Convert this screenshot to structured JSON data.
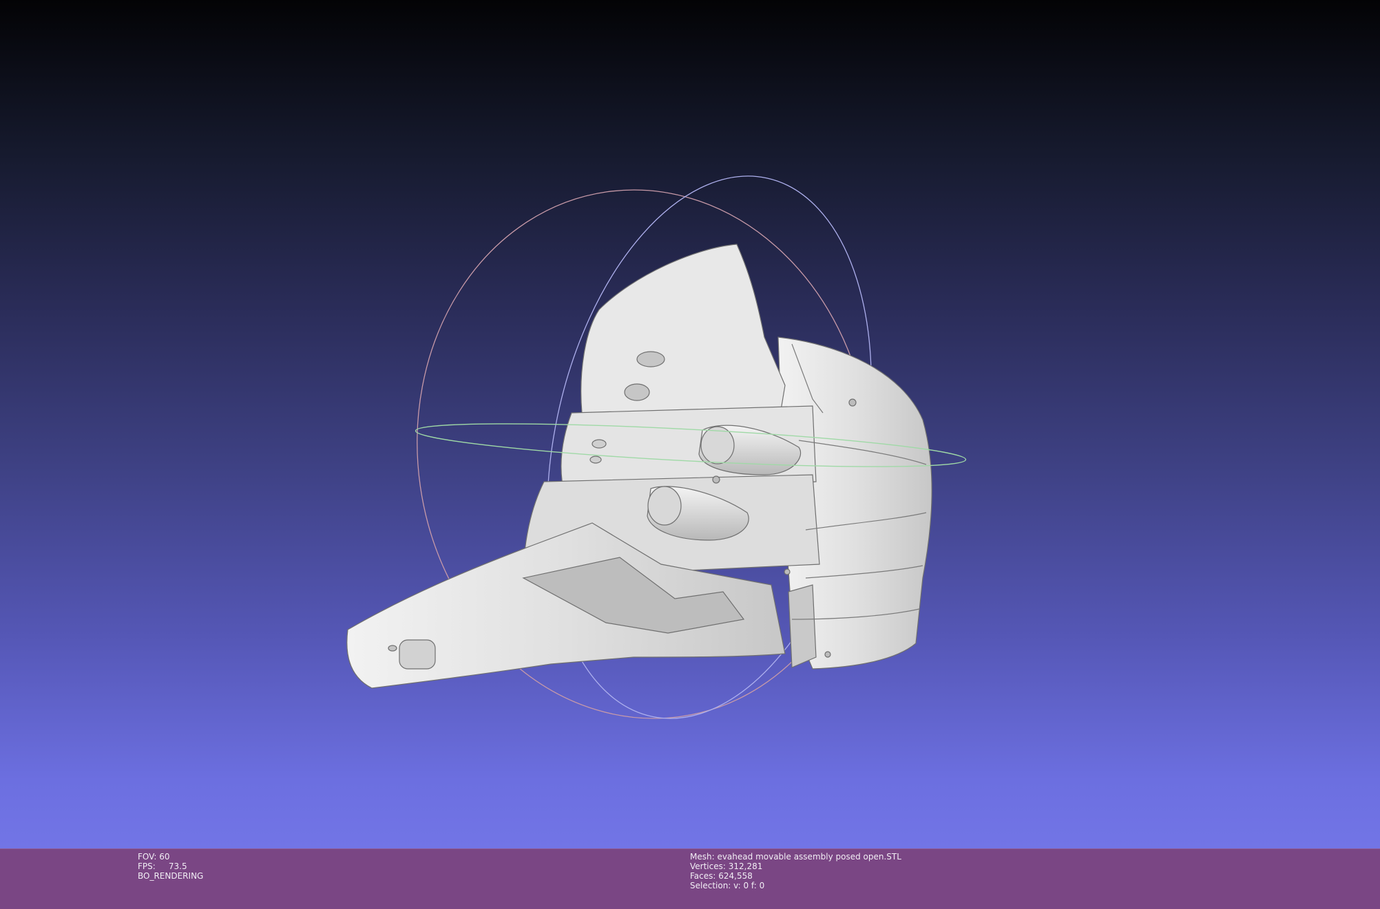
{
  "viewer": {
    "mesh_description": "white 3D mesh of a helmet assembly with trackball gizmo",
    "colors": {
      "background_top": "#030305",
      "background_bottom": "#7275e6",
      "info_bar": "#7a4684",
      "mesh": "#dcdcdc",
      "trackball_ring_red": "#c89aa8",
      "trackball_ring_green": "#9fd9a6",
      "trackball_ring_blue": "#a8a8e8"
    }
  },
  "status": {
    "fov": "FOV: 60",
    "fps": "FPS:     73.5",
    "render_mode": "BO_RENDERING",
    "mesh": "Mesh: evahead movable assembly posed open.STL",
    "vertices": "Vertices: 312,281",
    "faces": "Faces: 624,558",
    "selection": "Selection: v: 0 f: 0"
  }
}
